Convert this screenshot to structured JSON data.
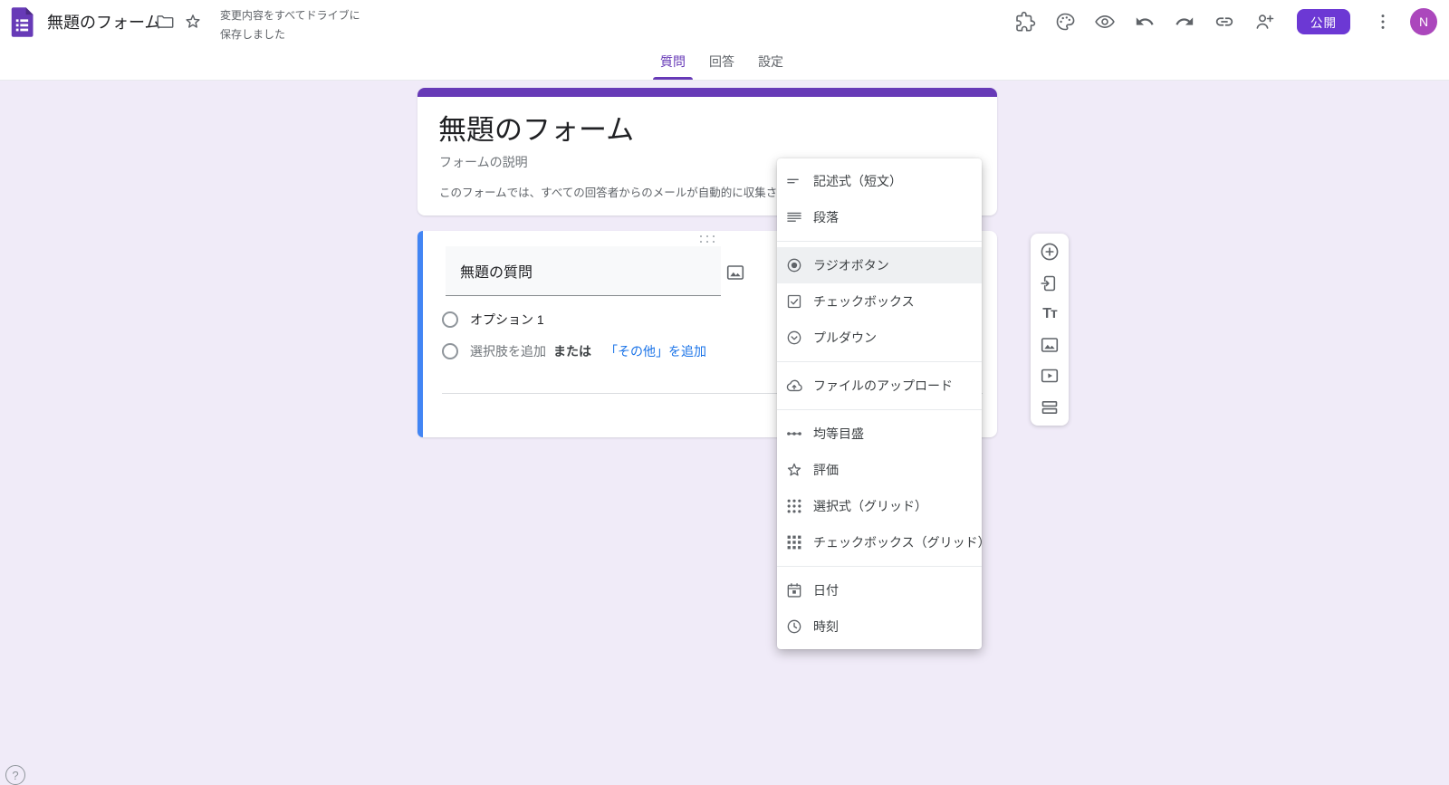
{
  "topbar": {
    "doc_title": "無題のフォーム",
    "save_status_line1": "変更内容をすべてドライブに",
    "save_status_line2": "保存しました",
    "publish_label": "公開",
    "avatar_initial": "N",
    "icons": [
      "forms-logo",
      "folder-icon",
      "star-icon",
      "addons-puzzle-icon",
      "theme-palette-icon",
      "preview-eye-icon",
      "undo-icon",
      "redo-icon",
      "copy-link-icon",
      "person-add-icon",
      "more-vert-icon"
    ]
  },
  "tabs": {
    "items": [
      {
        "label": "質問",
        "active": true
      },
      {
        "label": "回答",
        "active": false
      },
      {
        "label": "設定",
        "active": false
      }
    ]
  },
  "form_header": {
    "title": "無題のフォーム",
    "description_placeholder": "フォームの説明",
    "email_notice": "このフォームでは、すべての回答者からのメールが自動的に収集さ"
  },
  "question": {
    "title": "無題の質問",
    "option_1": "オプション 1",
    "add_option": "選択肢を追加",
    "or": "または",
    "add_other": "「その他」を追加",
    "icons": [
      "drag-handle",
      "image-icon",
      "radio-circle"
    ]
  },
  "type_menu": {
    "items": [
      {
        "icon": "short-answer-icon",
        "label": "記述式（短文）",
        "selected": false
      },
      {
        "icon": "paragraph-icon",
        "label": "段落",
        "selected": false
      },
      {
        "icon": "radio-checked-icon",
        "label": "ラジオボタン",
        "selected": true
      },
      {
        "icon": "checkbox-icon",
        "label": "チェックボックス",
        "selected": false
      },
      {
        "icon": "dropdown-icon",
        "label": "プルダウン",
        "selected": false
      },
      {
        "icon": "file-upload-icon",
        "label": "ファイルのアップロード",
        "selected": false
      },
      {
        "icon": "linear-scale-icon",
        "label": "均等目盛",
        "selected": false
      },
      {
        "icon": "rating-star-icon",
        "label": "評価",
        "selected": false
      },
      {
        "icon": "choice-grid-icon",
        "label": "選択式（グリッド）",
        "selected": false
      },
      {
        "icon": "checkbox-grid-icon",
        "label": "チェックボックス（グリッド）",
        "selected": false
      },
      {
        "icon": "date-icon",
        "label": "日付",
        "selected": false
      },
      {
        "icon": "time-icon",
        "label": "時刻",
        "selected": false
      }
    ]
  },
  "side_toolbar": {
    "icons": [
      "add-question-icon",
      "import-questions-icon",
      "add-title-icon",
      "add-image-icon",
      "add-video-icon",
      "add-section-icon"
    ]
  },
  "help": {
    "label": "?"
  },
  "colors": {
    "purple": "#673ab7",
    "publish_purple": "#6c38d4",
    "selected_blue": "#4285f4",
    "link_blue": "#1a73e8",
    "avatar_purple": "#ab47bc",
    "bg": "#f0ebf8"
  }
}
